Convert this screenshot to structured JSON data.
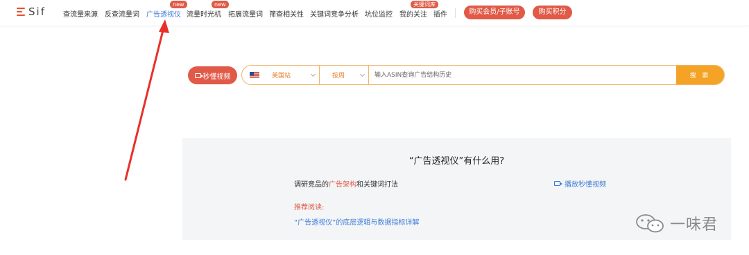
{
  "app": {
    "logo_text": "Sif"
  },
  "nav": {
    "items": [
      {
        "label": "查流量来源"
      },
      {
        "label": "反查流量词"
      },
      {
        "label": "广告透视仪",
        "badge": "new",
        "active": true
      },
      {
        "label": "流量时光机",
        "badge": "new"
      },
      {
        "label": "拓展流量词"
      },
      {
        "label": "筛查相关性"
      },
      {
        "label": "关键词竞争分析"
      },
      {
        "label": "坑位监控"
      },
      {
        "label": "我的关注",
        "badge": "关键词库"
      },
      {
        "label": "插件"
      }
    ],
    "buy_member": "购买会员/子账号",
    "buy_points": "购买积分"
  },
  "search": {
    "video_button": "秒懂视频",
    "marketplace": "美国站",
    "period": "按周",
    "placeholder": "输入ASIN查询广告结构历史",
    "button": "搜 索"
  },
  "panel": {
    "title": "“广告透视仪”有什么用?",
    "line_prefix": "调研竞品的",
    "line_highlight": "广告架构",
    "line_suffix": "和关键词打法",
    "play_link": "播放秒懂视频",
    "recommend_label": "推荐阅读:",
    "recommend_link": "“广告透视仪”的底层逻辑与数据指标详解"
  },
  "watermark": {
    "text": "一味君"
  },
  "colors": {
    "accent_red": "#e05a47",
    "link_blue": "#3b7bd6",
    "search_orange": "#f5a326",
    "arrow_red": "#e8302a"
  }
}
